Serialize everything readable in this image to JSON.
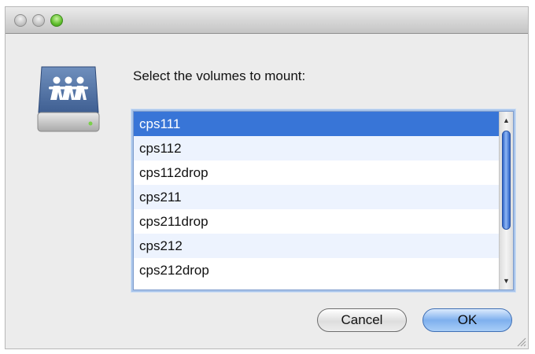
{
  "window": {
    "traffic_lights": [
      "close",
      "minimize",
      "zoom"
    ],
    "icon": "shared-network-drive-icon"
  },
  "dialog": {
    "prompt": "Select the volumes to mount:",
    "volumes": [
      "cps111",
      "cps112",
      "cps112drop",
      "cps211",
      "cps211drop",
      "cps212",
      "cps212drop"
    ],
    "selected_volume": "cps111",
    "scroll_up_glyph": "▲",
    "scroll_down_glyph": "▼"
  },
  "buttons": {
    "cancel_label": "Cancel",
    "ok_label": "OK"
  },
  "colors": {
    "selection": "#3875d7",
    "alt_row": "#edf3fe",
    "focus_ring": "#a8c4ea",
    "zoom_button": "#5fbe2c"
  }
}
